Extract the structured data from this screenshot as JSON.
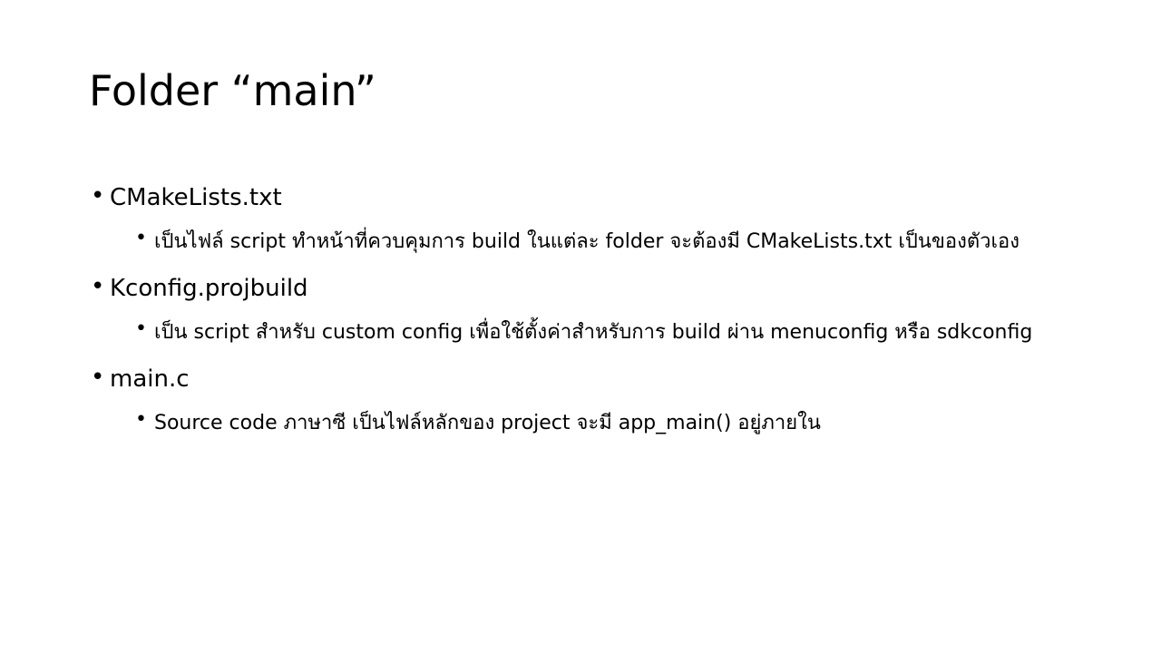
{
  "slide": {
    "title": "Folder “main”",
    "bullets": [
      {
        "label": "CMakeLists.txt",
        "subs": [
          {
            "text": "เป็นไฟล์ script ทำหน้าที่ควบคุมการ build ในแต่ละ folder  จะต้องมี CMakeLists.txt เป็นของตัวเอง"
          }
        ]
      },
      {
        "label": "Kconfig.projbuild",
        "subs": [
          {
            "text": "เป็น script สำหรับ custom config เพื่อใช้ตั้งค่าสำหรับการ build ผ่าน menuconfig หรือ sdkconfig"
          }
        ]
      },
      {
        "label": "main.c",
        "subs": [
          {
            "text": "Source code ภาษาซี เป็นไฟล์หลักของ project จะมี app_main()  อยู่ภายใน"
          }
        ]
      }
    ],
    "bullet_char": "•"
  }
}
